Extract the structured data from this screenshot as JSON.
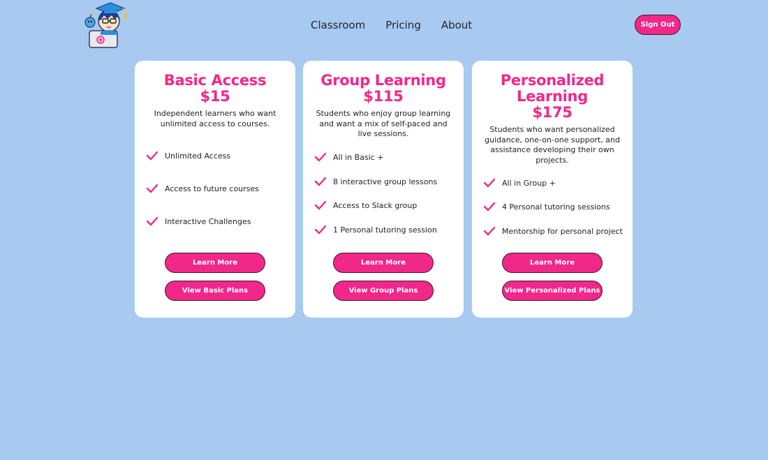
{
  "nav": {
    "items": [
      "Classroom",
      "Pricing",
      "About"
    ],
    "sign_out": "Sign Out"
  },
  "brand": {
    "accent_color": "#f2278a",
    "background_color": "#a8caf0",
    "logo_icon": "student-mascot-logo-icon"
  },
  "plans": [
    {
      "title": "Basic Access",
      "price": "$15",
      "description": "Independent learners who want unlimited access to courses.",
      "features": [
        "Unlimited Access",
        "Access to future courses",
        "Interactive Challenges"
      ],
      "learn_more": "Learn More",
      "view_plans": "View Basic Plans"
    },
    {
      "title": "Group Learning",
      "price": "$115",
      "description": "Students who enjoy group learning and want a mix of self-paced and live sessions.",
      "features": [
        "All in Basic +",
        "8 interactive group lessons",
        "Access to Slack group",
        "1 Personal tutoring session"
      ],
      "learn_more": "Learn More",
      "view_plans": "View Group Plans"
    },
    {
      "title": "Personalized Learning",
      "price": "$175",
      "description": "Students who want personalized guidance, one-on-one support, and assistance developing their own projects.",
      "features": [
        "All in Group +",
        "4 Personal tutoring sessions",
        "Mentorship for personal project"
      ],
      "learn_more": "Learn More",
      "view_plans": "View Personalized Plans"
    }
  ]
}
